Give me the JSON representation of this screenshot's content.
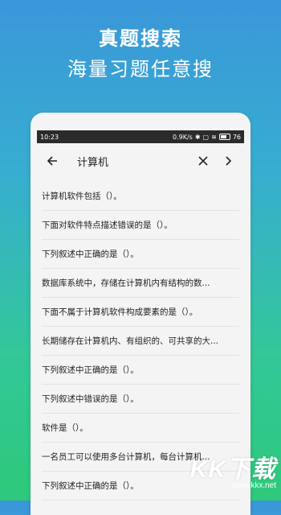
{
  "promo": {
    "title": "真题搜索",
    "subtitle": "海量习题任意搜"
  },
  "statusbar": {
    "time": "10:23",
    "speed": "0.9K/s",
    "battery": "76"
  },
  "search": {
    "query": "计算机",
    "back_icon": "arrow-left-icon",
    "clear_icon": "close-icon",
    "next_icon": "chevron-right-icon"
  },
  "results": [
    "计算机软件包括（）。",
    "下面对软件特点描述错误的是（）。",
    "下列叙述中正确的是（）。",
    "数据库系统中，存储在计算机内有结构的数...",
    "下面不属于计算机软件构成要素的是（）。",
    "长期储存在计算机内、有组织的、可共享的大...",
    "下列叙述中正确的是（）。",
    "下列叙述中错误的是（）。",
    "软件是（）。",
    "一名员工可以使用多台计算机，每台计算机...",
    "下列叙述中正确的是（）。"
  ],
  "watermark": {
    "main": "KK下载",
    "sub": "www.kkx.net"
  }
}
